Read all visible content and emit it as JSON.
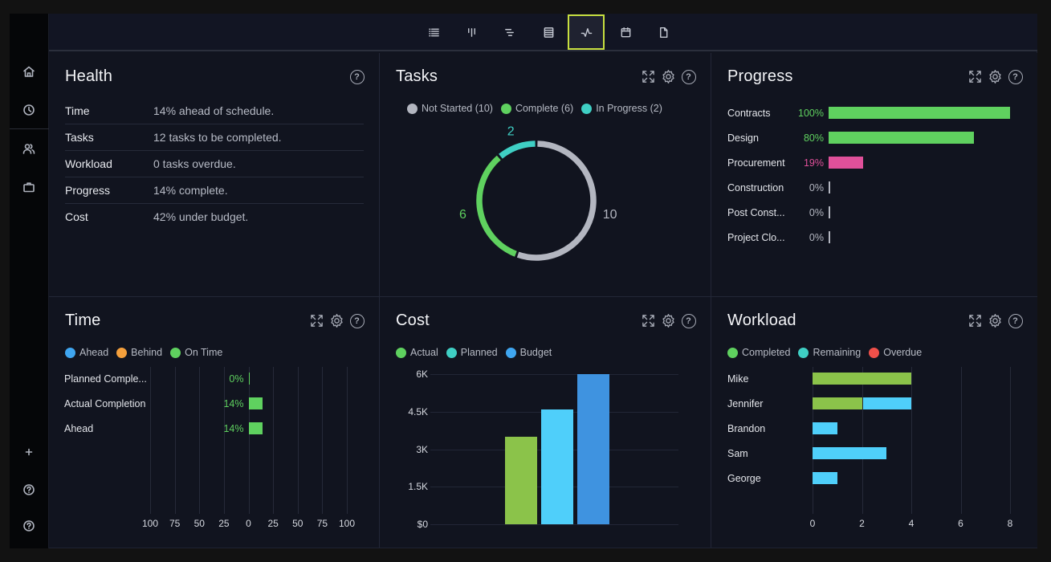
{
  "sidebar": {
    "top_items": [
      {
        "name": "home",
        "icon": "home-icon"
      },
      {
        "name": "recent",
        "icon": "clock-icon"
      }
    ],
    "mid_items": [
      {
        "name": "team",
        "icon": "users-icon"
      },
      {
        "name": "portfolio",
        "icon": "briefcase-icon"
      }
    ],
    "bottom_items": [
      {
        "name": "add",
        "icon": "plus-icon"
      },
      {
        "name": "help",
        "icon": "help-icon"
      },
      {
        "name": "support",
        "icon": "help-icon"
      }
    ]
  },
  "toolbar": {
    "views": [
      {
        "name": "list-view",
        "icon": "list-icon"
      },
      {
        "name": "board-view",
        "icon": "board-icon"
      },
      {
        "name": "gantt-view",
        "icon": "gantt-icon"
      },
      {
        "name": "sheet-view",
        "icon": "sheet-icon"
      },
      {
        "name": "dashboard-view",
        "icon": "pulse-icon",
        "active": true
      },
      {
        "name": "calendar-view",
        "icon": "calendar-icon"
      },
      {
        "name": "files-view",
        "icon": "file-icon"
      }
    ]
  },
  "health": {
    "title": "Health",
    "help": "?",
    "rows": [
      {
        "label": "Time",
        "value": "14% ahead of schedule."
      },
      {
        "label": "Tasks",
        "value": "12 tasks to be completed."
      },
      {
        "label": "Workload",
        "value": "0 tasks overdue."
      },
      {
        "label": "Progress",
        "value": "14% complete."
      },
      {
        "label": "Cost",
        "value": "42% under budget."
      }
    ]
  },
  "tasks": {
    "title": "Tasks",
    "help": "?",
    "legend": [
      {
        "label": "Not Started (10)",
        "color": "#b3b6c0"
      },
      {
        "label": "Complete (6)",
        "color": "#5fd15f"
      },
      {
        "label": "In Progress (2)",
        "color": "#3fcfc4"
      }
    ]
  },
  "progress": {
    "title": "Progress",
    "help": "?"
  },
  "time": {
    "title": "Time",
    "help": "?",
    "legend": [
      {
        "label": "Ahead",
        "color": "#3fa6f0"
      },
      {
        "label": "Behind",
        "color": "#f5a03c"
      },
      {
        "label": "On Time",
        "color": "#5fd15f"
      }
    ]
  },
  "cost": {
    "title": "Cost",
    "help": "?",
    "legend": [
      {
        "label": "Actual",
        "color": "#5fd15f"
      },
      {
        "label": "Planned",
        "color": "#3fcfc4"
      },
      {
        "label": "Budget",
        "color": "#3fa6f0"
      }
    ]
  },
  "workload": {
    "title": "Workload",
    "help": "?",
    "legend": [
      {
        "label": "Completed",
        "color": "#5fd15f"
      },
      {
        "label": "Remaining",
        "color": "#3fcfc4"
      },
      {
        "label": "Overdue",
        "color": "#f0504a"
      }
    ]
  },
  "chart_data": [
    {
      "id": "tasks",
      "type": "pie",
      "title": "Tasks",
      "donut": true,
      "categories": [
        "Not Started",
        "Complete",
        "In Progress"
      ],
      "values": [
        10,
        6,
        2
      ],
      "colors": [
        "#b3b6c0",
        "#5fd15f",
        "#3fcfc4"
      ],
      "data_labels": [
        "10",
        "6",
        "2"
      ]
    },
    {
      "id": "progress",
      "type": "bar",
      "orientation": "horizontal",
      "title": "Progress",
      "categories": [
        "Contracts",
        "Design",
        "Procurement",
        "Construction",
        "Post Const...",
        "Project Clo..."
      ],
      "values": [
        100,
        80,
        19,
        0,
        0,
        0
      ],
      "data_labels": [
        "100%",
        "80%",
        "19%",
        "0%",
        "0%",
        "0%"
      ],
      "colors": [
        "#5fd15f",
        "#5fd15f",
        "#e0509a",
        "#b3b6c0",
        "#b3b6c0",
        "#b3b6c0"
      ],
      "label_colors": [
        "#5fd15f",
        "#5fd15f",
        "#e0509a",
        "#b3b6c0",
        "#b3b6c0",
        "#b3b6c0"
      ],
      "xlim": [
        0,
        100
      ]
    },
    {
      "id": "time",
      "type": "bar",
      "orientation": "horizontal",
      "title": "Time",
      "categories": [
        "Planned Comple...",
        "Actual Completion",
        "Ahead"
      ],
      "values": [
        0,
        14,
        14
      ],
      "data_labels": [
        "0%",
        "14%",
        "14%"
      ],
      "color": "#5fd15f",
      "xlim": [
        -100,
        100
      ],
      "xticks": [
        "100",
        "75",
        "50",
        "25",
        "0",
        "25",
        "50",
        "75",
        "100"
      ],
      "legend": [
        "Ahead",
        "Behind",
        "On Time"
      ],
      "grid": true
    },
    {
      "id": "cost",
      "type": "bar",
      "title": "Cost",
      "categories": [
        "Actual",
        "Planned",
        "Budget"
      ],
      "values": [
        3500,
        4600,
        6000
      ],
      "colors": [
        "#8bc34a",
        "#4fcffa",
        "#3f93e0"
      ],
      "ylim": [
        0,
        6000
      ],
      "yticks": [
        "$0",
        "1.5K",
        "3K",
        "4.5K",
        "6K"
      ],
      "grid": true
    },
    {
      "id": "workload",
      "type": "bar",
      "orientation": "horizontal",
      "stacked": true,
      "title": "Workload",
      "categories": [
        "Mike",
        "Jennifer",
        "Brandon",
        "Sam",
        "George"
      ],
      "series": [
        {
          "name": "Completed",
          "values": [
            4,
            2,
            0,
            0,
            0
          ],
          "color": "#8bc34a"
        },
        {
          "name": "Remaining",
          "values": [
            0,
            2,
            1,
            3,
            1
          ],
          "color": "#4fcffa"
        },
        {
          "name": "Overdue",
          "values": [
            0,
            0,
            0,
            0,
            0
          ],
          "color": "#f0504a"
        }
      ],
      "xlim": [
        0,
        8
      ],
      "xticks": [
        "0",
        "2",
        "4",
        "6",
        "8"
      ],
      "grid": true
    }
  ]
}
